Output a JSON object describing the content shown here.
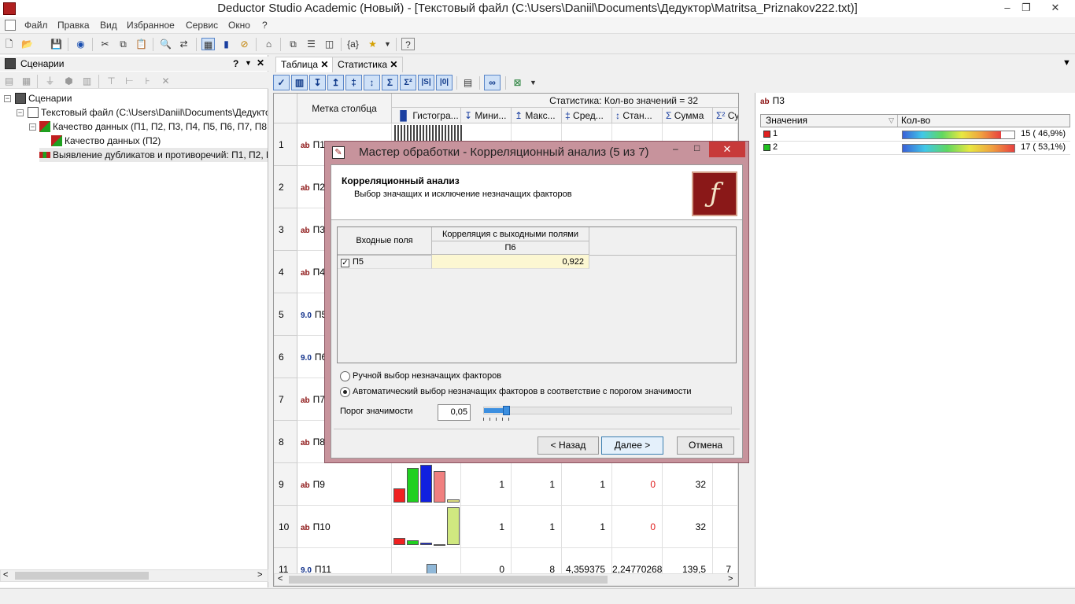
{
  "window": {
    "title": "Deductor Studio Academic (Новый) - [Текстовый файл (C:\\Users\\Daniil\\Documents\\Дедуктор\\Matritsa_Priznakov222.txt)]"
  },
  "menu": [
    "Файл",
    "Правка",
    "Вид",
    "Избранное",
    "Сервис",
    "Окно",
    "?"
  ],
  "left_panel": {
    "title": "Сценарии",
    "tree": [
      "Сценарии",
      "Текстовый файл (C:\\Users\\Daniil\\Documents\\Дедуктор\\M",
      "Качество данных (П1, П2, П3, П4, П5, П6, П7, П8, П9,",
      "Качество данных (П2)",
      "Выявление дубликатов и противоречий: П1, П2, П3, П"
    ]
  },
  "tabs": [
    "Таблица",
    "Статистика"
  ],
  "grid": {
    "stat_title": "Статистика: Кол-во значений = 32",
    "col_label_header": "Метка столбца",
    "columns": [
      "Гистогра...",
      "Мини...",
      "Макс...",
      "Сред...",
      "Стан...",
      "Сумма",
      "Су"
    ],
    "rows": [
      {
        "num": "1",
        "type": "ab",
        "name": "П1"
      },
      {
        "num": "2",
        "type": "ab",
        "name": "П2"
      },
      {
        "num": "3",
        "type": "ab",
        "name": "П3"
      },
      {
        "num": "4",
        "type": "ab",
        "name": "П4"
      },
      {
        "num": "5",
        "type": "9.0",
        "name": "П5"
      },
      {
        "num": "6",
        "type": "9.0",
        "name": "П6"
      },
      {
        "num": "7",
        "type": "ab",
        "name": "П7"
      },
      {
        "num": "8",
        "type": "ab",
        "name": "П8"
      },
      {
        "num": "9",
        "type": "ab",
        "name": "П9",
        "min": "1",
        "max": "1",
        "avg": "1",
        "std": "0",
        "sum": "32"
      },
      {
        "num": "10",
        "type": "ab",
        "name": "П10",
        "min": "1",
        "max": "1",
        "avg": "1",
        "std": "0",
        "sum": "32"
      },
      {
        "num": "11",
        "type": "9.0",
        "name": "П11",
        "min": "0",
        "max": "8",
        "avg": "4,359375",
        "std": "2,24770268",
        "sum": "139,5",
        "extra": "7"
      }
    ]
  },
  "right_panel": {
    "title": "П3",
    "type_tag": "ab",
    "col_values": "Значения",
    "col_count": "Кол-во",
    "rows": [
      {
        "value": "1",
        "count_label": "15 ( 46,9%)",
        "fraction": 0.469,
        "color": "#e02020"
      },
      {
        "value": "2",
        "count_label": "17 ( 53,1%)",
        "fraction": 0.531,
        "color": "#20c020"
      }
    ]
  },
  "dialog": {
    "title": "Мастер обработки - Корреляционный анализ (5 из 7)",
    "heading": "Корреляционный анализ",
    "subheading": "Выбор значащих и исключение незначащих факторов",
    "table_col_inputs": "Входные поля",
    "table_col_corr": "Корреляция с выходными полями",
    "table_col_output": "П6",
    "table_rows": [
      {
        "field": "П5",
        "checked": true,
        "value": "0,922"
      }
    ],
    "radio_manual": "Ручной выбор незначащих факторов",
    "radio_auto": "Автоматический выбор незначащих факторов в соответствие с порогом значимости",
    "threshold_label": "Порог значимости",
    "threshold_value": "0,05",
    "threshold_fraction": 0.05,
    "btn_back": "< Назад",
    "btn_next": "Далее >",
    "btn_cancel": "Отмена"
  }
}
